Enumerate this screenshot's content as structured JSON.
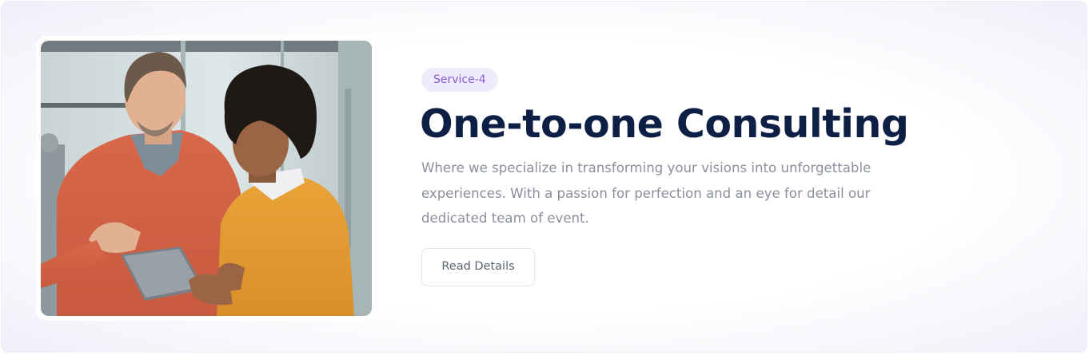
{
  "service": {
    "badge": "Service-4",
    "title": "One-to-one Consulting",
    "description": "Where we specialize in transforming your visions into unforgettable experiences. With a passion for perfection and an eye for detail our dedicated team of event.",
    "button_label": "Read Details"
  },
  "colors": {
    "title": "#0d1f45",
    "badge_text": "#8a5ad6",
    "badge_bg": "#eeecfb",
    "body_text": "#8b8f9c"
  }
}
